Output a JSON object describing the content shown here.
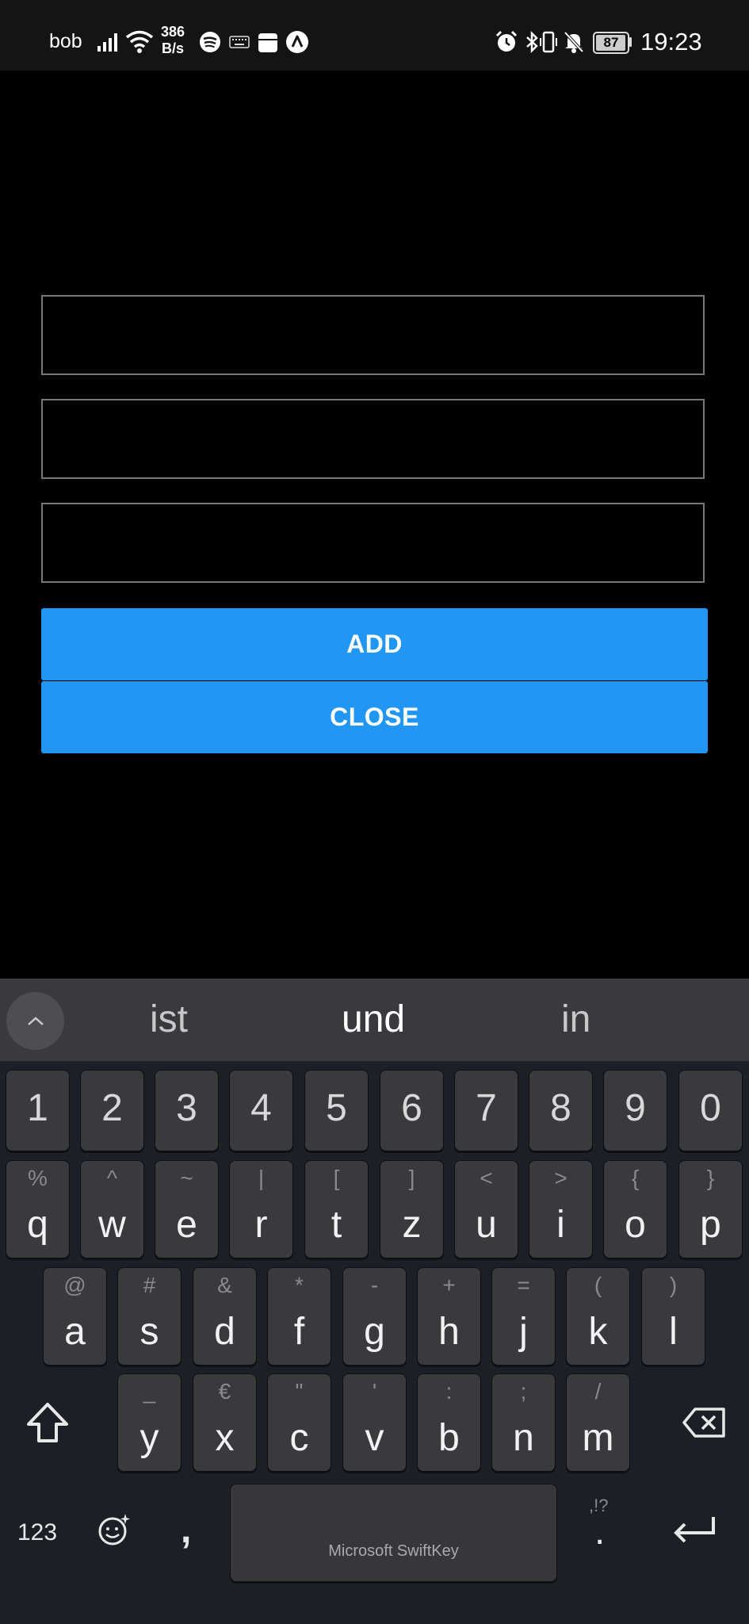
{
  "status_bar": {
    "carrier": "bob",
    "speed_value": "386",
    "speed_unit": "B/s",
    "battery": "87",
    "time": "19:23",
    "icons": [
      "signal-icon",
      "wifi-icon",
      "spotify-icon",
      "keyboard-icon",
      "calendar-icon",
      "app-icon",
      "alarm-icon",
      "bluetooth-icon",
      "vibrate-icon",
      "mute-icon",
      "battery-icon"
    ]
  },
  "form": {
    "fields": [
      {
        "value": "",
        "placeholder": ""
      },
      {
        "value": "",
        "placeholder": ""
      },
      {
        "value": "",
        "placeholder": ""
      }
    ],
    "add_label": "ADD",
    "close_label": "CLOSE"
  },
  "keyboard": {
    "suggestions": [
      "ist",
      "und",
      "in"
    ],
    "number_row": [
      "1",
      "2",
      "3",
      "4",
      "5",
      "6",
      "7",
      "8",
      "9",
      "0"
    ],
    "row1": [
      {
        "main": "q",
        "alt": "%"
      },
      {
        "main": "w",
        "alt": "^"
      },
      {
        "main": "e",
        "alt": "~"
      },
      {
        "main": "r",
        "alt": "|"
      },
      {
        "main": "t",
        "alt": "["
      },
      {
        "main": "z",
        "alt": "]"
      },
      {
        "main": "u",
        "alt": "<"
      },
      {
        "main": "i",
        "alt": ">"
      },
      {
        "main": "o",
        "alt": "{"
      },
      {
        "main": "p",
        "alt": "}"
      }
    ],
    "row2": [
      {
        "main": "a",
        "alt": "@"
      },
      {
        "main": "s",
        "alt": "#"
      },
      {
        "main": "d",
        "alt": "&"
      },
      {
        "main": "f",
        "alt": "*"
      },
      {
        "main": "g",
        "alt": "-"
      },
      {
        "main": "h",
        "alt": "+"
      },
      {
        "main": "j",
        "alt": "="
      },
      {
        "main": "k",
        "alt": "("
      },
      {
        "main": "l",
        "alt": ")"
      }
    ],
    "row3": [
      {
        "main": "y",
        "alt": "_"
      },
      {
        "main": "x",
        "alt": "€"
      },
      {
        "main": "c",
        "alt": "\""
      },
      {
        "main": "v",
        "alt": "'"
      },
      {
        "main": "b",
        "alt": ":"
      },
      {
        "main": "n",
        "alt": ";"
      },
      {
        "main": "m",
        "alt": "/"
      }
    ],
    "numbers_toggle": "123",
    "comma": ",",
    "space_label": "Microsoft SwiftKey",
    "period": ".",
    "period_alt": ",!?",
    "accent_color": "#2196f3"
  }
}
